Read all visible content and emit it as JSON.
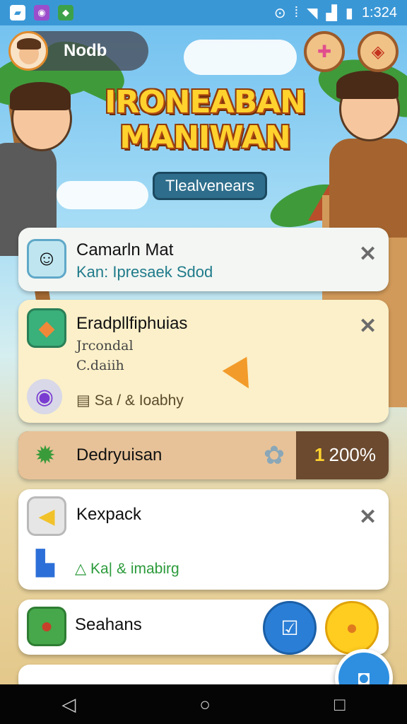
{
  "status_bar": {
    "time": "1:324",
    "app_icons": [
      "image-icon",
      "app-icon-purple",
      "app-icon-green"
    ],
    "system_icons": [
      "sync-icon",
      "vibrate-icon",
      "wifi-icon",
      "signal-icon",
      "battery-icon"
    ]
  },
  "profile": {
    "name": "Nodb"
  },
  "top_buttons": [
    "bandage-icon",
    "map-icon"
  ],
  "title": {
    "line1": "IRONEABAN",
    "line2": "MANIWAN",
    "subtitle": "Tlealvenears"
  },
  "cards": [
    {
      "title": "Camarln Mat",
      "subtitle": "Kan: Ipresaek Sdod",
      "icon": "character-face-icon",
      "subtitle_color": "#1f7b8a"
    },
    {
      "title": "Eradpllfiphuias",
      "line1": "Jrcondal",
      "line2": "C.daiih",
      "footer": "Sa / & Ioabhy",
      "icon": "carrot-icon",
      "footer_icon": "camera-lens-icon"
    },
    {
      "title": "Kexpack",
      "footer": "Ka| & imabirg",
      "icon": "triangle-flag-icon",
      "footer_icon": "puzzle-icon"
    },
    {
      "title": "Seahans",
      "icon": "seed-icon"
    }
  ],
  "progress": {
    "label": "Dedryuisan",
    "prefix": "1",
    "value": "200%",
    "fill_fraction": 0.75
  },
  "fab_icon": "camera-icon",
  "nav": [
    "back-icon",
    "home-icon",
    "recents-icon"
  ]
}
